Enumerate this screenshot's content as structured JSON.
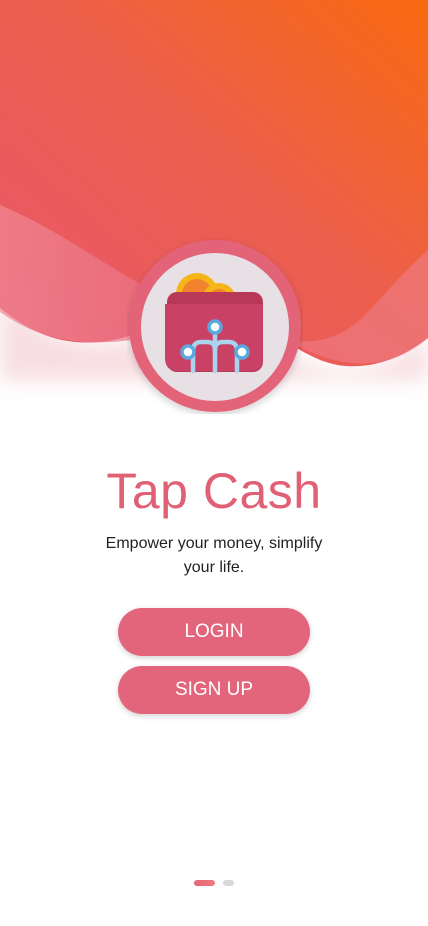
{
  "app": {
    "title": "Tap Cash",
    "tagline": "Empower your money, simplify your life."
  },
  "buttons": {
    "login_label": "LOGIN",
    "signup_label": "SIGN UP"
  },
  "icons": {
    "logo": "wallet-coins-circuit-icon"
  },
  "pager": {
    "total": 2,
    "active": 1
  },
  "colors": {
    "accent": "#e2657c",
    "title": "#e06176",
    "gradient_start": "#e8606f",
    "gradient_end": "#f7661a"
  }
}
